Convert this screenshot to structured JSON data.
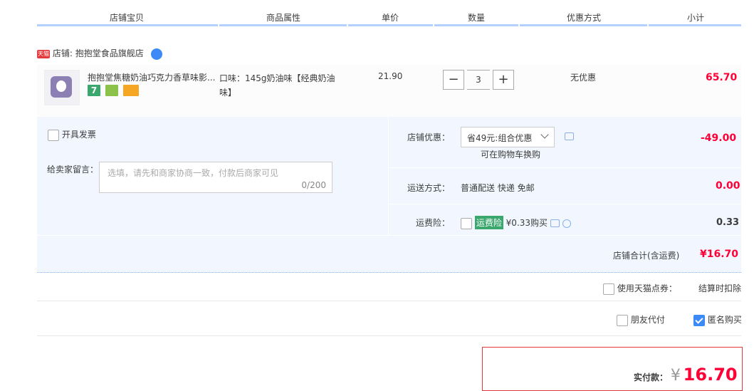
{
  "columns": [
    "店铺宝贝",
    "商品属性",
    "单价",
    "数量",
    "优惠方式",
    "小计"
  ],
  "store": {
    "badge": "天猫",
    "label": "店铺:",
    "name": "抱抱堂食品旗舰店"
  },
  "item": {
    "title": "抱抱堂焦糖奶油巧克力香草味影...",
    "attr_line1": "口味：145g奶油味【经典奶油",
    "attr_line2": "味】",
    "unit_price": "21.90",
    "quantity": "3",
    "minus": "−",
    "plus": "+",
    "discount": "无优惠",
    "subtotal": "65.70",
    "badge_seven": "7",
    "colors": {
      "seven": "#3aa76d",
      "shield": "#8bc34a",
      "card": "#f5a623"
    }
  },
  "invoice_label": "开具发票",
  "memo": {
    "label": "给卖家留言：",
    "placeholder": "选填，请先和商家协商一致，付款后商家可见",
    "counter": "0/200"
  },
  "store_discount": {
    "label": "店铺优惠：",
    "selected": "省49元:组合优惠",
    "note": "可在购物车换购",
    "amount": "-49.00"
  },
  "shipping": {
    "label": "运送方式：",
    "value": "普通配送 快递 免邮",
    "amount": "0.00"
  },
  "insurance": {
    "label": "运费险：",
    "tag": "运费险",
    "price": "¥0.33购买",
    "amount": "0.33"
  },
  "store_total": {
    "label": "店铺合计(含运费)",
    "amount": "¥16.70"
  },
  "points": {
    "label": "使用天猫点券：",
    "note": "结算时扣除"
  },
  "friend_pay": "朋友代付",
  "anonymous": "匿名购买",
  "pay": {
    "label": "实付款：",
    "currency": "¥",
    "amount": "16.70"
  },
  "accent": "#ff0036"
}
